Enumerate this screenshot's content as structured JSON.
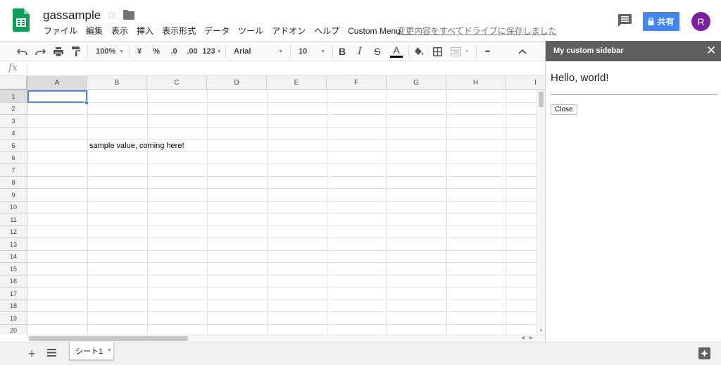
{
  "header": {
    "title": "gassample",
    "save_status": "変更内容をすべてドライブに保存しました",
    "share_label": "共有",
    "avatar_initial": "R"
  },
  "menu": [
    "ファイル",
    "編集",
    "表示",
    "挿入",
    "表示形式",
    "データ",
    "ツール",
    "アドオン",
    "ヘルプ",
    "Custom Menu"
  ],
  "toolbar": {
    "zoom": "100%",
    "currency": "¥",
    "percent": "%",
    "decimal_decrease": ".0",
    "decimal_increase": ".00",
    "number_format": "123",
    "font": "Arial",
    "font_size": "10",
    "bold": "B",
    "italic": "I",
    "strike": "S",
    "text_color": "A",
    "more": "•••"
  },
  "formula_bar": {
    "label": "fx",
    "value": ""
  },
  "grid": {
    "columns": [
      "A",
      "B",
      "C",
      "D",
      "E",
      "F",
      "G",
      "H",
      "I"
    ],
    "rows": [
      "1",
      "2",
      "3",
      "4",
      "5",
      "6",
      "7",
      "8",
      "9",
      "10",
      "11",
      "12",
      "13",
      "14",
      "15",
      "16",
      "17",
      "18",
      "19",
      "20"
    ],
    "selected_cell": "A1",
    "cells": [
      {
        "ref": "B5",
        "value": "sample value, coming here!"
      }
    ]
  },
  "sheets": [
    {
      "name": "シート1",
      "active": true
    }
  ],
  "sidebar": {
    "title": "My custom sidebar",
    "greeting": "Hello, world!",
    "close_button": "Close"
  },
  "colors": {
    "share_blue": "#4285f4",
    "avatar_purple": "#7b1fa2",
    "sheets_green": "#0f9d58",
    "sidebar_header": "#5f5f5f",
    "selection_blue": "#4a89dc"
  }
}
